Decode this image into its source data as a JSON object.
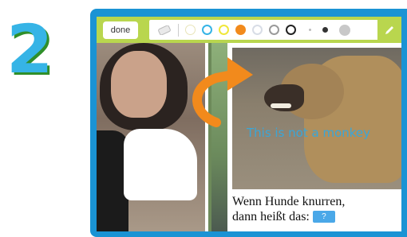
{
  "step_number": "2",
  "toolbar": {
    "done_label": "done",
    "colors": [
      "#ffffff",
      "#36b4e6",
      "#f0e73a",
      "#f28a1c",
      "#d8dde6",
      "#bfbfbf",
      "#222222"
    ],
    "selected_color": "#f28a1c",
    "sizes": [
      "small",
      "medium",
      "large"
    ]
  },
  "annotation": {
    "text": "This is not a monkey",
    "color": "#3aa6d8",
    "arrow_color": "#f28a1c"
  },
  "caption": {
    "line1": "Wenn Hunde knurren,",
    "line2": "dann heißt das:",
    "blank_label": "?"
  }
}
